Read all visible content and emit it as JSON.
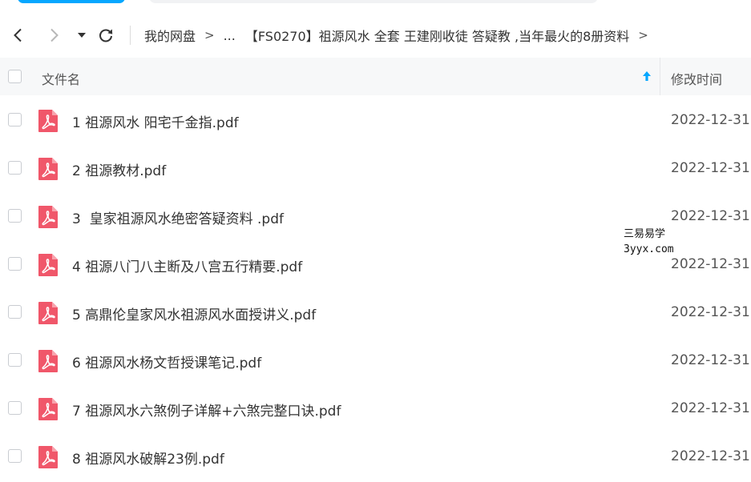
{
  "breadcrumb": {
    "root": "我的网盘",
    "ellipsis": "...",
    "current": "【FS0270】祖源风水 全套 王建刚收徒 答疑教 ,当年最火的8册资料",
    "sep": ">"
  },
  "header": {
    "name_label": "文件名",
    "time_label": "修改时间"
  },
  "files": [
    {
      "name": "1 祖源风水 阳宅千金指.pdf",
      "date": "2022-12-31"
    },
    {
      "name": "2 祖源教材.pdf",
      "date": "2022-12-31"
    },
    {
      "name": "3  皇家祖源风水绝密答疑资料 .pdf",
      "date": "2022-12-31"
    },
    {
      "name": "4 祖源八门八主断及八宫五行精要.pdf",
      "date": "2022-12-31"
    },
    {
      "name": "5 高鼎伦皇家风水祖源风水面授讲义.pdf",
      "date": "2022-12-31"
    },
    {
      "name": "6 祖源风水杨文哲授课笔记.pdf",
      "date": "2022-12-31"
    },
    {
      "name": "7 祖源风水六煞例子详解+六煞完整口诀.pdf",
      "date": "2022-12-31"
    },
    {
      "name": "8 祖源风水破解23例.pdf",
      "date": "2022-12-31"
    }
  ],
  "watermark": {
    "line1": "三易易学",
    "line2": "3yyx.com"
  },
  "colors": {
    "accent": "#06a7ff",
    "pdf_icon": "#f0576a",
    "header_bg": "#f7f8f9"
  },
  "icons": {
    "file_type": "pdf-file-icon",
    "sort": "sort-ascending-arrow-icon"
  }
}
